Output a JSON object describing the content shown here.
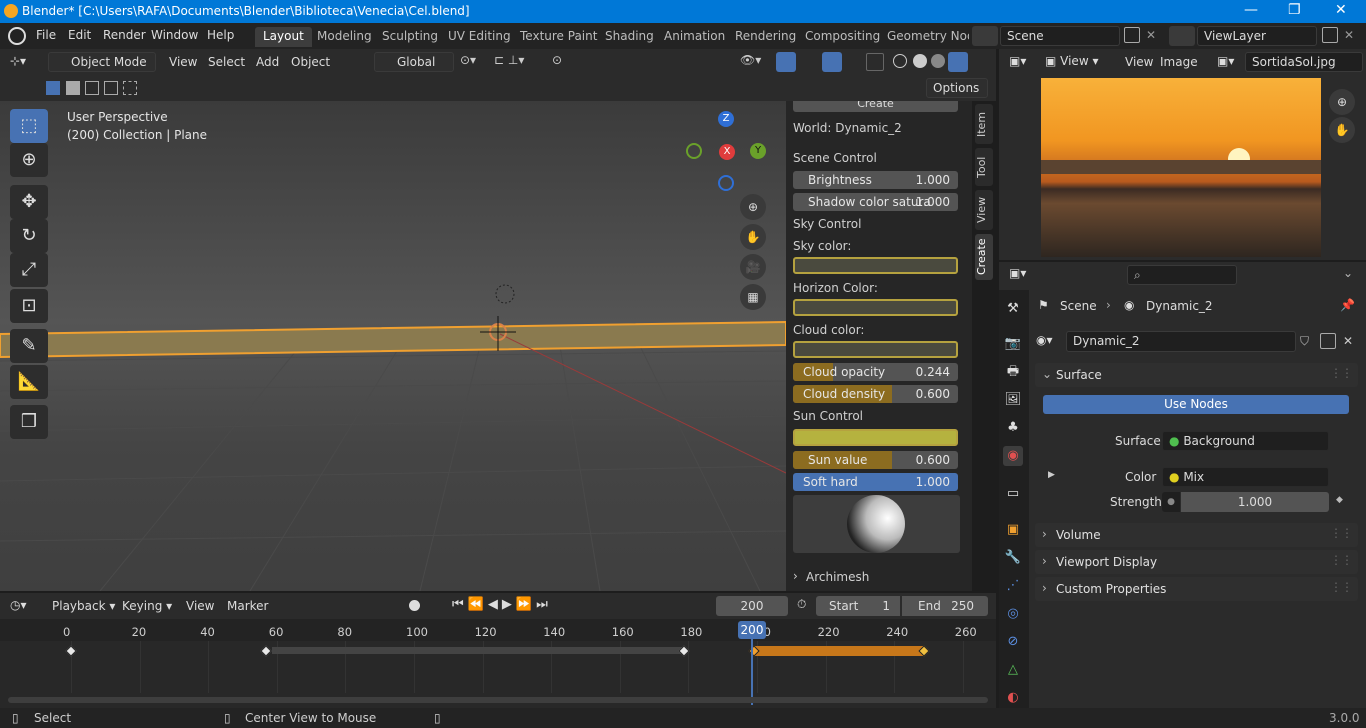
{
  "titlebar": {
    "title": "Blender* [C:\\Users\\RAFA\\Documents\\Blender\\Biblioteca\\Venecia\\Cel.blend]",
    "minimize": "—",
    "maximize": "❐",
    "close": "✕"
  },
  "menu": [
    "File",
    "Edit",
    "Render",
    "Window",
    "Help"
  ],
  "workspaces": [
    "Layout",
    "Modeling",
    "Sculpting",
    "UV Editing",
    "Texture Paint",
    "Shading",
    "Animation",
    "Rendering",
    "Compositing",
    "Geometry Nod"
  ],
  "scene": {
    "name": "Scene",
    "viewlayer": "ViewLayer"
  },
  "viewport_header": {
    "mode": "Object Mode",
    "items": [
      "View",
      "Select",
      "Add",
      "Object"
    ],
    "orientation": "Global",
    "options": "Options"
  },
  "viewport": {
    "perspective": "User Perspective",
    "collection": "(200) Collection | Plane",
    "gizmo": {
      "x": "X",
      "y": "Y",
      "z": "Z"
    }
  },
  "npanel": {
    "create_btn": "Create",
    "world": "World: Dynamic_2",
    "scene_control": "Scene Control",
    "brightness": {
      "label": "Brightness",
      "value": "1.000"
    },
    "shadow": {
      "label": "Shadow color satura",
      "value": "1.000"
    },
    "sky_control": "Sky Control",
    "sky_color": "Sky color:",
    "horizon_color": "Horizon Color:",
    "cloud_color": "Cloud color:",
    "cloud_opacity": {
      "label": "Cloud opacity",
      "value": "0.244",
      "fraction": 0.244
    },
    "cloud_density": {
      "label": "Cloud density",
      "value": "0.600",
      "fraction": 0.6
    },
    "sun_control": "Sun Control",
    "sun_value": {
      "label": "Sun value",
      "value": "0.600",
      "fraction": 0.6
    },
    "soft_hard": {
      "label": "Soft hard",
      "value": "1.000"
    },
    "archimesh": "Archimesh",
    "tabs": [
      "Item",
      "Tool",
      "View",
      "Create"
    ]
  },
  "image_editor": {
    "view": "View",
    "items": [
      "View",
      "Image"
    ],
    "image_name": "SortidaSol.jpg"
  },
  "properties": {
    "search_placeholder": "",
    "breadcrumb_scene": "Scene",
    "breadcrumb_world": "Dynamic_2",
    "world_name": "Dynamic_2",
    "surface_section": "Surface",
    "use_nodes": "Use Nodes",
    "surface_label": "Surface",
    "surface_value": "Background",
    "color_label": "Color",
    "color_value": "Mix",
    "strength_label": "Strength",
    "strength_value": "1.000",
    "sections": [
      "Volume",
      "Viewport Display",
      "Custom Properties"
    ]
  },
  "timeline": {
    "menus": [
      "Playback",
      "Keying",
      "View",
      "Marker"
    ],
    "current_frame": "200",
    "start_label": "Start",
    "start": "1",
    "end_label": "End",
    "end": "250",
    "ticks": [
      "0",
      "20",
      "40",
      "60",
      "80",
      "100",
      "120",
      "140",
      "160",
      "180",
      "200",
      "220",
      "240",
      "260"
    ]
  },
  "status": {
    "select": "Select",
    "center": "Center View to Mouse",
    "version": "3.0.0"
  }
}
